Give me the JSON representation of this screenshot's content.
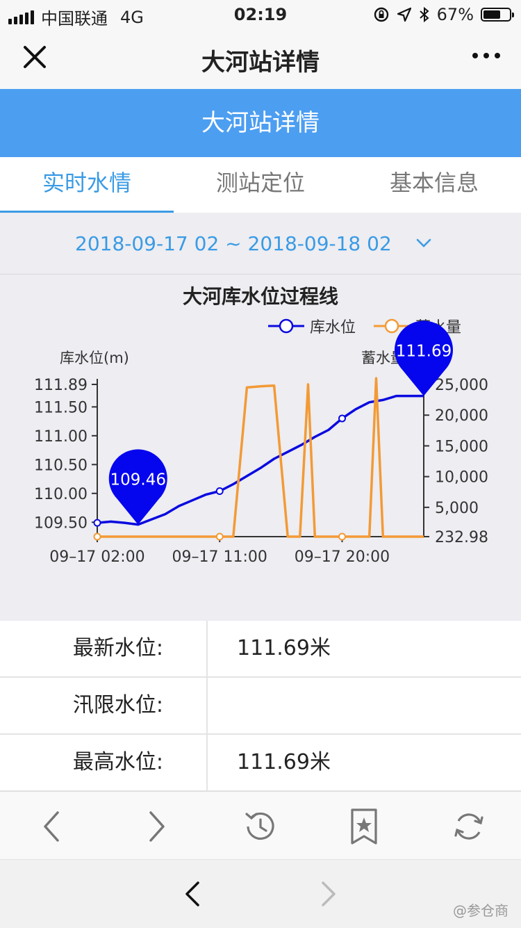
{
  "status_bar": {
    "carrier": "中国联通",
    "network": "4G",
    "time": "02:19",
    "battery": "67%",
    "battery_level": 0.67
  },
  "nav": {
    "title": "大河站详情"
  },
  "header": {
    "title": "大河站详情"
  },
  "tabs": [
    {
      "label": "实时水情",
      "active": true
    },
    {
      "label": "测站定位",
      "active": false
    },
    {
      "label": "基本信息",
      "active": false
    }
  ],
  "date_range": "2018-09-17 02 ~ 2018-09-18 02",
  "chart_data": {
    "type": "line",
    "title": "大河库水位过程线",
    "legend": [
      "库水位",
      "蓄水量"
    ],
    "legend_placement": "top-right",
    "y_left": {
      "name": "库水位(m)",
      "ticks": [
        "111.89",
        "111.50",
        "111.00",
        "110.50",
        "110.00",
        "109.50"
      ],
      "range": [
        109.25,
        111.89
      ]
    },
    "y_right": {
      "name": "蓄水量(m³)",
      "ticks": [
        "25,000",
        "20,000",
        "15,000",
        "10,000",
        "5,000",
        "232.98"
      ],
      "range": [
        232.98,
        25000
      ]
    },
    "x_ticks": [
      "09–17 02:00",
      "09–17 11:00",
      "09–17 20:00"
    ],
    "x_range": [
      0,
      24
    ],
    "series": [
      {
        "name": "库水位",
        "color": "#0a0ae0",
        "x": [
          0,
          1,
          2,
          3,
          4,
          5,
          6,
          7,
          8,
          9,
          10,
          11,
          12,
          13,
          14,
          15,
          16,
          17,
          18,
          19,
          20,
          21,
          22,
          23,
          24
        ],
        "y": [
          109.49,
          109.51,
          109.49,
          109.46,
          109.55,
          109.64,
          109.78,
          109.88,
          109.98,
          110.04,
          110.16,
          110.3,
          110.44,
          110.6,
          110.72,
          110.84,
          110.98,
          111.1,
          111.3,
          111.46,
          111.58,
          111.62,
          111.69,
          111.69,
          111.69
        ],
        "markers": [
          0,
          9,
          18
        ]
      },
      {
        "name": "蓄水量",
        "color": "#f39a35",
        "x": [
          0,
          9,
          10,
          11,
          12,
          13,
          14,
          14.9,
          15.5,
          16,
          17,
          18,
          19,
          20,
          20.5,
          21,
          22,
          23,
          24
        ],
        "y": [
          232.98,
          232.98,
          232.98,
          24500,
          24700,
          24800,
          232.98,
          232.98,
          25000,
          232.98,
          232.98,
          232.98,
          232.98,
          232.98,
          26000,
          232.98,
          232.98,
          232.98,
          232.98
        ],
        "markers": [
          0,
          9,
          18
        ]
      }
    ],
    "annotations": [
      {
        "label": "109.46",
        "series": 0,
        "x": 3,
        "y": 109.46
      },
      {
        "label": "111.69",
        "series": 0,
        "x": 24,
        "y": 111.69
      }
    ]
  },
  "info_rows": [
    {
      "label": "最新水位:",
      "value": "111.69米"
    },
    {
      "label": "汛限水位:",
      "value": ""
    },
    {
      "label": "最高水位:",
      "value": "111.69米"
    }
  ],
  "toolbar_icons": [
    "back-arrow-icon",
    "forward-arrow-icon",
    "history-icon",
    "bookmark-icon",
    "refresh-icon"
  ],
  "watermark": "@参仓商"
}
